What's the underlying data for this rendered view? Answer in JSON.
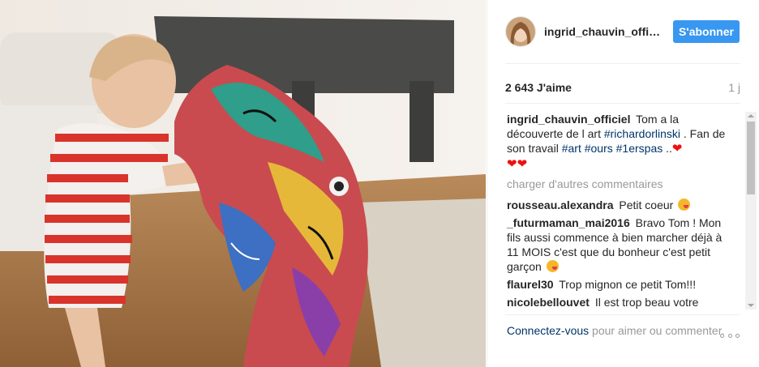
{
  "post": {
    "image_alt": "",
    "username": "ingrid_chauvin_officiel",
    "follow_label": "S'abonner",
    "likes": "2 643 J'aime",
    "time": "1 j",
    "caption": {
      "user": "ingrid_chauvin_officiel",
      "text_1": "Tom a la découverte de l art ",
      "tag_1": "#richardorlinski",
      "text_2": " . Fan de son travail ",
      "tag_2": "#art",
      "tag_3": "#ours",
      "tag_4": "#1erspas",
      "text_3": " ..",
      "hearts_inline": "❤",
      "hearts_line": "❤❤"
    },
    "load_more": "charger d'autres commentaires",
    "comments": [
      {
        "user": "rousseau.alexandra",
        "text": "Petit coeur"
      },
      {
        "user": "_futurmaman_mai2016",
        "text": "Bravo Tom ! Mon fils aussi commence à bien marcher déjà à 11 MOIS c'est que du bonheur c'est petit garçon"
      },
      {
        "user": "flaurel30",
        "text": "Trop mignon ce petit Tom!!!"
      },
      {
        "user": "nicolebellouvet",
        "text": "Il est trop beau votre"
      }
    ],
    "footer": {
      "login_link": "Connectez-vous",
      "rest": " pour aimer ou commenter."
    }
  },
  "colors": {
    "accent": "#3897f0",
    "link": "#003569",
    "muted": "#999999"
  },
  "icons": {
    "more": "more-options-icon",
    "heart": "heart-emoji",
    "emoji": "kissing-face-emoji"
  }
}
